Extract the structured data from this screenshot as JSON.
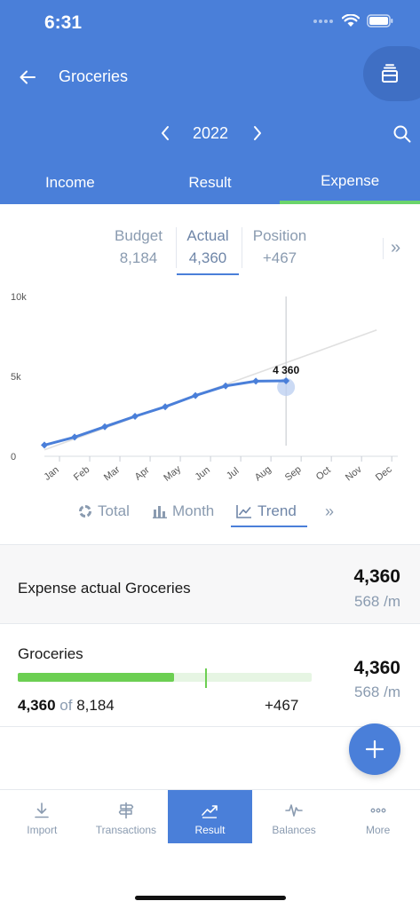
{
  "status_bar": {
    "time": "6:31"
  },
  "header": {
    "title": "Groceries",
    "year": "2022",
    "tabs": [
      {
        "label": "Income",
        "active": false
      },
      {
        "label": "Result",
        "active": false
      },
      {
        "label": "Expense",
        "active": true
      }
    ],
    "colors": {
      "background": "#4a7fd9",
      "active_tab_indicator": "#6bd46b"
    }
  },
  "metrics": {
    "budget": {
      "label": "Budget",
      "value": "8,184"
    },
    "actual": {
      "label": "Actual",
      "value": "4,360",
      "selected": true
    },
    "position": {
      "label": "Position",
      "value": "+467"
    },
    "more_icon": "double-chevron-right"
  },
  "chart_data": {
    "type": "line",
    "categories": [
      "Jan",
      "Feb",
      "Mar",
      "Apr",
      "May",
      "Jun",
      "Jul",
      "Aug",
      "Sep",
      "Oct",
      "Nov",
      "Dec"
    ],
    "series": [
      {
        "values": [
          700,
          1200,
          1850,
          2500,
          3100,
          3800,
          4400,
          4700,
          4720
        ]
      }
    ],
    "budget_line": {
      "values": [
        400,
        1082,
        1764,
        2446,
        3128,
        3810,
        4492,
        5174,
        5856,
        6538,
        7220,
        7902
      ]
    },
    "annotation": {
      "label": "4 360",
      "x": "Aug"
    },
    "yticks": [
      {
        "value": 0,
        "label": "0"
      },
      {
        "value": 5000,
        "label": "5k"
      },
      {
        "value": 10000,
        "label": "10k"
      }
    ],
    "ylim": [
      0,
      10000
    ],
    "grid": true,
    "colors": {
      "series": "#4a7fd9",
      "budget_line": "#e0e0e0",
      "cursor": "#c2c6cc"
    }
  },
  "chart_modes": [
    {
      "label": "Total",
      "icon": "donut-icon",
      "active": false
    },
    {
      "label": "Month",
      "icon": "bar-chart-icon",
      "active": false
    },
    {
      "label": "Trend",
      "icon": "trend-icon",
      "active": true
    }
  ],
  "summary": {
    "title": "Expense actual Groceries",
    "amount": "4,360",
    "rate": "568 /m"
  },
  "category_row": {
    "name": "Groceries",
    "used": "4,360",
    "of_word": "of",
    "total": "8,184",
    "diff": "+467",
    "amount": "4,360",
    "rate": "568 /m",
    "progress_fraction": 0.533,
    "expected_fraction": 0.636
  },
  "bottom_nav": [
    {
      "label": "Import",
      "icon": "download-icon",
      "active": false
    },
    {
      "label": "Transactions",
      "icon": "signpost-icon",
      "active": false
    },
    {
      "label": "Result",
      "icon": "trend-icon",
      "active": true
    },
    {
      "label": "Balances",
      "icon": "pulse-icon",
      "active": false
    },
    {
      "label": "More",
      "icon": "more-dots-icon",
      "active": false
    }
  ]
}
